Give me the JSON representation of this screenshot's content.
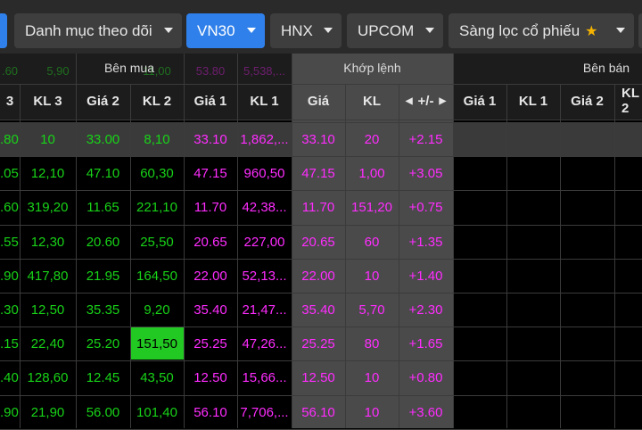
{
  "tabs": [
    {
      "label": "",
      "active": false
    },
    {
      "label": "Danh mục theo dõi",
      "active": false
    },
    {
      "label": "VN30",
      "active": true
    },
    {
      "label": "HNX",
      "active": false
    },
    {
      "label": "UPCOM",
      "active": false
    },
    {
      "label": "Sàng lọc cổ phiếu",
      "active": false
    }
  ],
  "groups": {
    "buy": "Bên mua",
    "match": "Khớp lệnh",
    "sell": "Bên bán"
  },
  "ghost_row": [
    ".60",
    "5,90",
    "",
    "11,00",
    "53.80",
    "5,538,..."
  ],
  "columns": [
    "3",
    "KL 3",
    "Giá 2",
    "KL 2",
    "Giá 1",
    "KL 1",
    "Giá",
    "KL",
    "+/-",
    "Giá 1",
    "KL 1",
    "Giá 2",
    "KL 2"
  ],
  "rows": [
    {
      "c3": ".80",
      "kl3": "10",
      "gia2": "33.00",
      "kl2": "8,10",
      "gia1": "33.10",
      "kl1": "1,862,...",
      "gia": "33.10",
      "kl": "20",
      "chg": "+2.15"
    },
    {
      "c3": ".05",
      "kl3": "12,10",
      "gia2": "47.10",
      "kl2": "60,30",
      "gia1": "47.15",
      "kl1": "960,50",
      "gia": "47.15",
      "kl": "1,00",
      "chg": "+3.05"
    },
    {
      "c3": ".60",
      "kl3": "319,20",
      "gia2": "11.65",
      "kl2": "221,10",
      "gia1": "11.70",
      "kl1": "42,38...",
      "gia": "11.70",
      "kl": "151,20",
      "chg": "+0.75"
    },
    {
      "c3": ".55",
      "kl3": "12,30",
      "gia2": "20.60",
      "kl2": "25,50",
      "gia1": "20.65",
      "kl1": "227,00",
      "gia": "20.65",
      "kl": "60",
      "chg": "+1.35"
    },
    {
      "c3": ".90",
      "kl3": "417,80",
      "gia2": "21.95",
      "kl2": "164,50",
      "gia1": "22.00",
      "kl1": "52,13...",
      "gia": "22.00",
      "kl": "10",
      "chg": "+1.40"
    },
    {
      "c3": ".30",
      "kl3": "12,50",
      "gia2": "35.35",
      "kl2": "9,20",
      "gia1": "35.40",
      "kl1": "21,47...",
      "gia": "35.40",
      "kl": "5,70",
      "chg": "+2.30"
    },
    {
      "c3": ".15",
      "kl3": "22,40",
      "gia2": "25.20",
      "kl2": "151,50",
      "gia1": "25.25",
      "kl1": "47,26...",
      "gia": "25.25",
      "kl": "80",
      "chg": "+1.65"
    },
    {
      "c3": ".40",
      "kl3": "128,60",
      "gia2": "12.45",
      "kl2": "43,50",
      "gia1": "12.50",
      "kl1": "15,66...",
      "gia": "12.50",
      "kl": "10",
      "chg": "+0.80"
    },
    {
      "c3": ".90",
      "kl3": "21,90",
      "gia2": "56.00",
      "kl2": "101,40",
      "gia1": "56.10",
      "kl1": "7,706,...",
      "gia": "56.10",
      "kl": "10",
      "chg": "+3.60"
    }
  ],
  "colors": {
    "green": "#18d318",
    "magenta": "#ff2cff",
    "active_tab": "#2f80ea",
    "highlight": "#22c922"
  }
}
